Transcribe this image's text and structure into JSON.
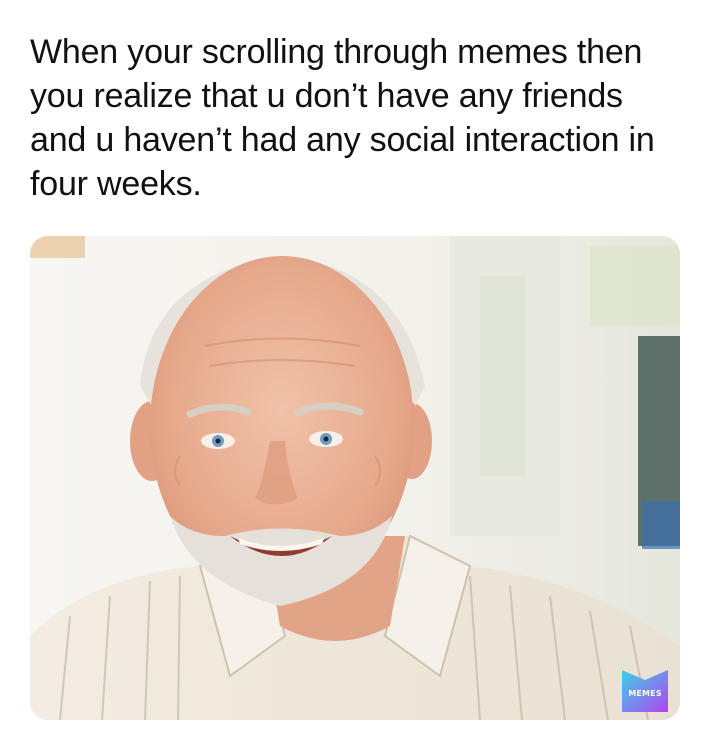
{
  "meme": {
    "caption": "When your scrolling through memes then\nyou realize that u don’t have any friends\nand u haven’t had any social interaction in\nfour weeks.",
    "watermark_label": "MEMES"
  },
  "colors": {
    "text": "#111111",
    "background": "#ffffff",
    "watermark_gradient_start": "#3bd3e8",
    "watermark_gradient_end": "#b044f0"
  }
}
